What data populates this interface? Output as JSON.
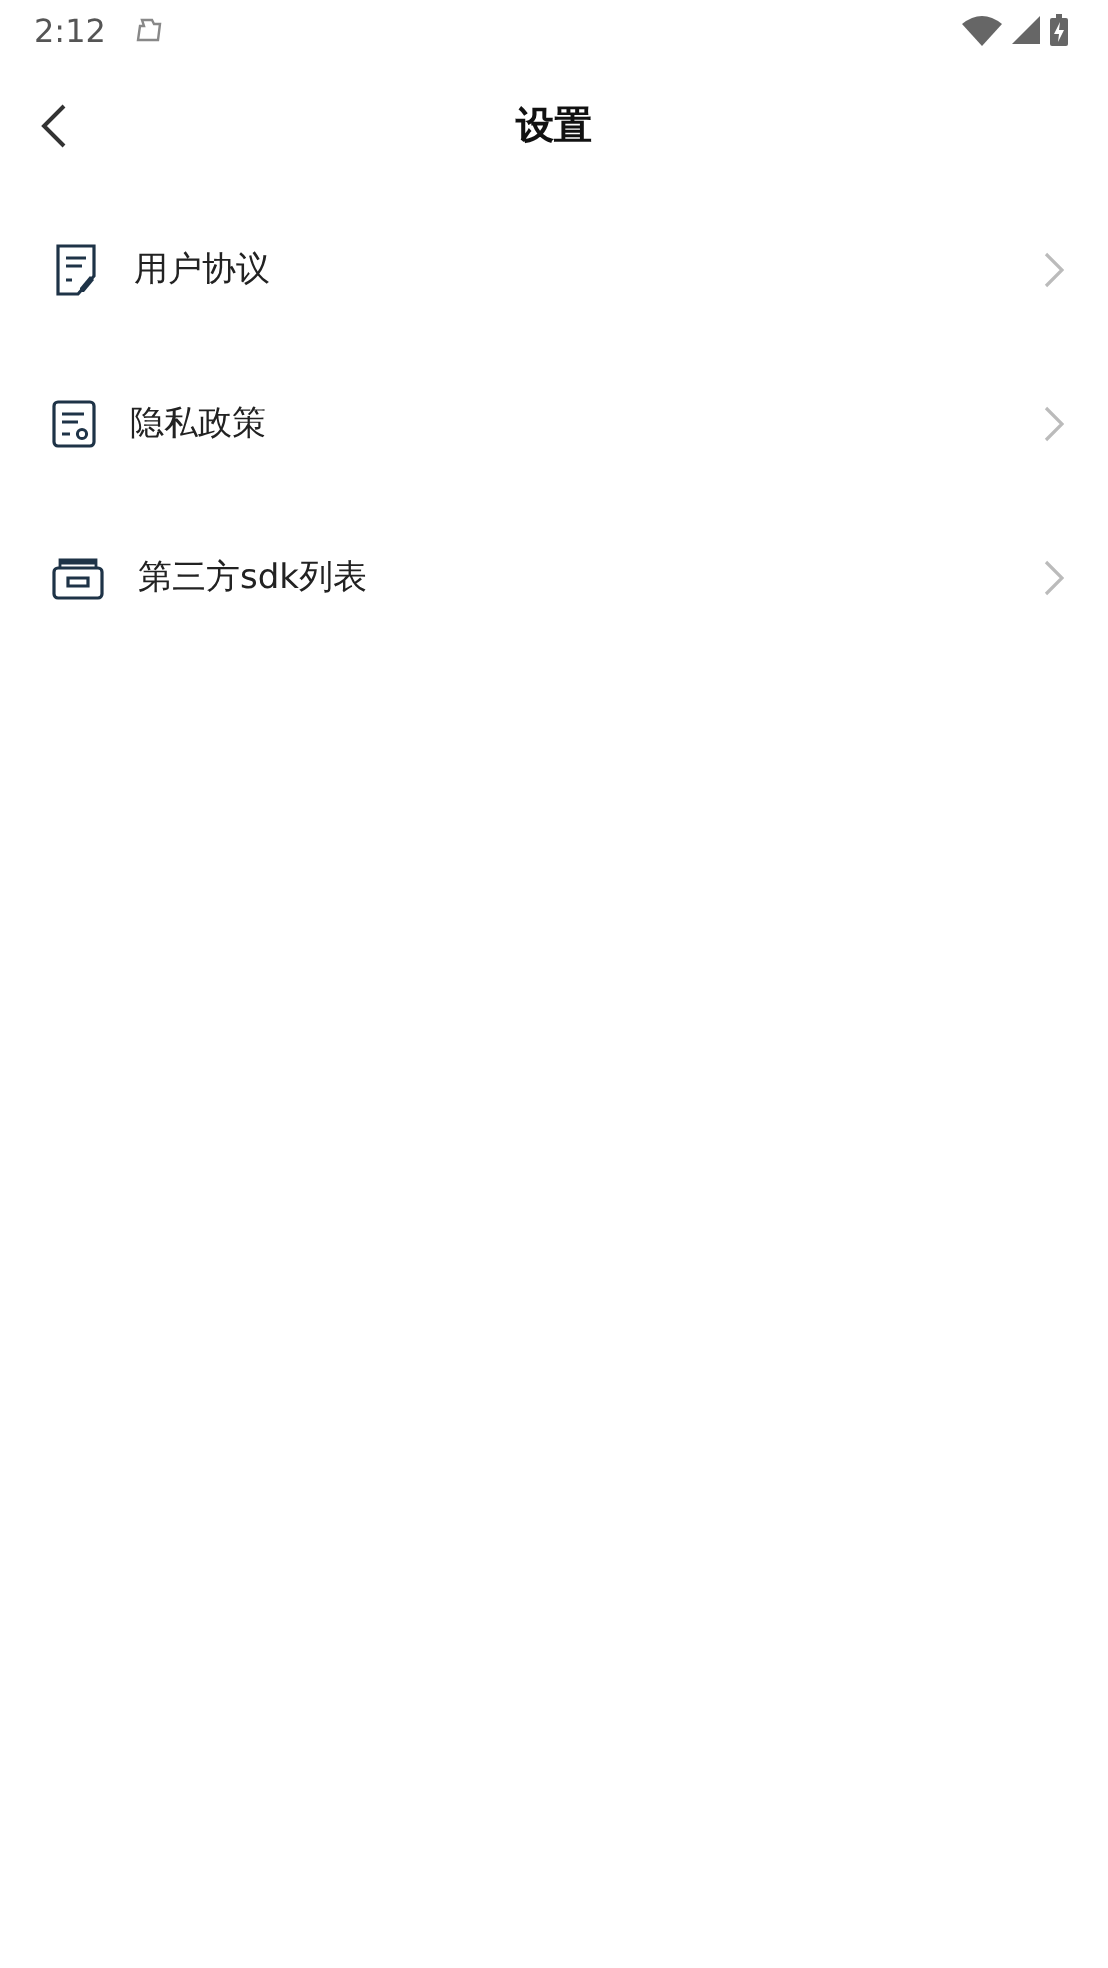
{
  "status_bar": {
    "time": "2:12"
  },
  "header": {
    "title": "设置"
  },
  "items": [
    {
      "kind": "document-pen",
      "label": "用户协议"
    },
    {
      "kind": "document-seal",
      "label": "隐私政策"
    },
    {
      "kind": "box",
      "label": "第三方sdk列表"
    }
  ]
}
